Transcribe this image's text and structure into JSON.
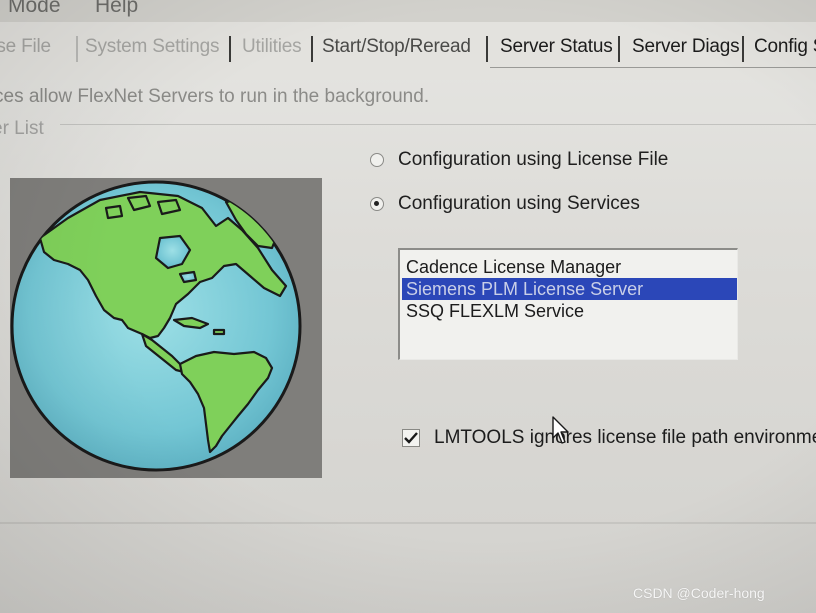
{
  "menubar": {
    "items": [
      "Mode",
      "Help"
    ]
  },
  "tabs": [
    {
      "label": "nse File"
    },
    {
      "label": "System Settings"
    },
    {
      "label": "Utilities"
    },
    {
      "label": "Start/Stop/Reread"
    },
    {
      "label": "Server Status"
    },
    {
      "label": "Server Diags"
    },
    {
      "label": "Config S"
    }
  ],
  "description": "ces allow FlexNet Servers to run in the background.",
  "group_label": "er List",
  "config": {
    "options": [
      {
        "label": "Configuration using License File",
        "checked": false
      },
      {
        "label": "Configuration using Services",
        "checked": true
      }
    ]
  },
  "services": {
    "items": [
      "Cadence License Manager",
      "Siemens PLM License Server",
      "SSQ FLEXLM Service"
    ],
    "selected_index": 1
  },
  "lmtools_checkbox": {
    "label": "LMTOOLS ignores license file path environmen",
    "checked": true
  },
  "watermark": "CSDN @Coder-hong",
  "colors": {
    "selection": "#2b47b8",
    "ocean": "#73c6d4",
    "land": "#7fd05a"
  }
}
